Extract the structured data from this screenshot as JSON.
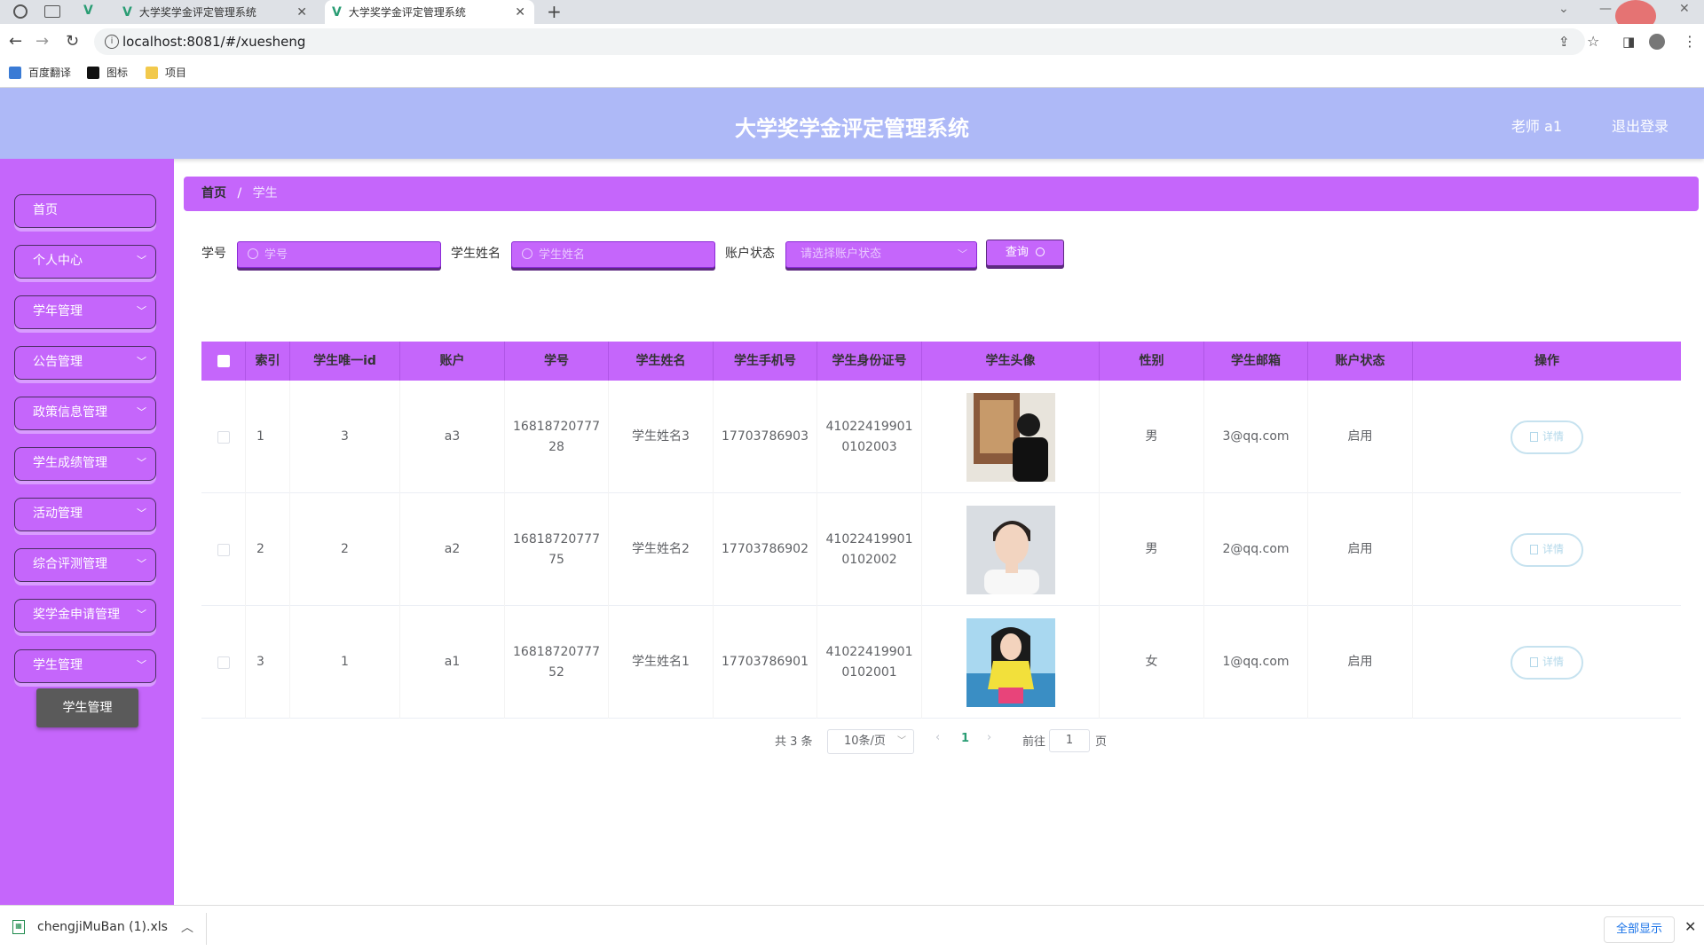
{
  "browser": {
    "tabs": [
      {
        "title": "大学奖学金评定管理系统"
      },
      {
        "title": "大学奖学金评定管理系统"
      }
    ],
    "url": "localhost:8081/#/xuesheng",
    "bookmarks": [
      {
        "label": "百度翻译"
      },
      {
        "label": "图标"
      },
      {
        "label": "项目"
      }
    ]
  },
  "app": {
    "title": "大学奖学金评定管理系统",
    "user": "老师 a1",
    "logout": "退出登录"
  },
  "sidebar": {
    "items": [
      {
        "label": "首页"
      },
      {
        "label": "个人中心"
      },
      {
        "label": "学年管理"
      },
      {
        "label": "公告管理"
      },
      {
        "label": "政策信息管理"
      },
      {
        "label": "学生成绩管理"
      },
      {
        "label": "活动管理"
      },
      {
        "label": "综合评测管理"
      },
      {
        "label": "奖学金申请管理"
      },
      {
        "label": "学生管理"
      }
    ],
    "submenu": "学生管理"
  },
  "breadcrumb": {
    "home": "首页",
    "separator": "/",
    "current": "学生"
  },
  "search": {
    "xuehao_label": "学号",
    "xuehao_placeholder": "学号",
    "name_label": "学生姓名",
    "name_placeholder": "学生姓名",
    "status_label": "账户状态",
    "status_placeholder": "请选择账户状态",
    "query_button": "查询"
  },
  "table": {
    "columns": [
      "索引",
      "学生唯一id",
      "账户",
      "学号",
      "学生姓名",
      "学生手机号",
      "学生身份证号",
      "学生头像",
      "性别",
      "学生邮箱",
      "账户状态",
      "操作"
    ],
    "rows": [
      {
        "index": "1",
        "uid": "3",
        "account": "a3",
        "xuehao": "16818720777\n28",
        "name": "学生姓名3",
        "phone": "17703786903",
        "idcard": "41022419901\n0102003",
        "gender": "男",
        "email": "3@qq.com",
        "status": "启用",
        "action": "详情"
      },
      {
        "index": "2",
        "uid": "2",
        "account": "a2",
        "xuehao": "16818720777\n75",
        "name": "学生姓名2",
        "phone": "17703786902",
        "idcard": "41022419901\n0102002",
        "gender": "男",
        "email": "2@qq.com",
        "status": "启用",
        "action": "详情"
      },
      {
        "index": "3",
        "uid": "1",
        "account": "a1",
        "xuehao": "16818720777\n52",
        "name": "学生姓名1",
        "phone": "17703786901",
        "idcard": "41022419901\n0102001",
        "gender": "女",
        "email": "1@qq.com",
        "status": "启用",
        "action": "详情"
      }
    ]
  },
  "pagination": {
    "total": "共 3 条",
    "page_size": "10条/页",
    "current_page": "1",
    "goto_label": "前往",
    "goto_value": "1",
    "page_suffix": "页"
  },
  "download": {
    "filename": "chengjiMuBan (1).xls",
    "show_all": "全部显示"
  },
  "colors": {
    "accent": "#c566fb",
    "header": "#aeb9f7"
  }
}
